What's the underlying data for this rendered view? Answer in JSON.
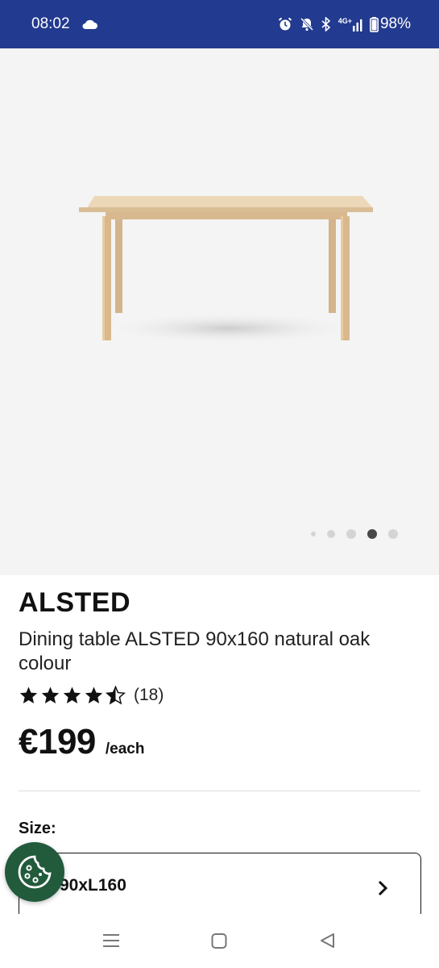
{
  "status_bar": {
    "time": "08:02",
    "network": "4G+",
    "battery": "98%"
  },
  "gallery": {
    "image_count": 5,
    "active_index": 3
  },
  "product": {
    "name": "ALSTED",
    "description": "Dining table ALSTED 90x160 natural oak colour",
    "rating": 4.5,
    "rating_count": "(18)",
    "price": "€199",
    "price_unit": "/each"
  },
  "size": {
    "label": "Size:",
    "value": "90xL160"
  },
  "colors": {
    "status_bar": "#223a8f",
    "cookie_button": "#225a3c"
  }
}
